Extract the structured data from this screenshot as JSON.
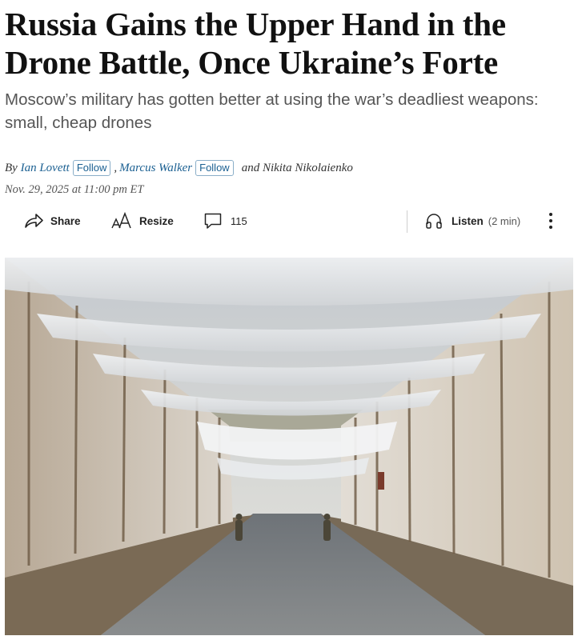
{
  "article": {
    "headline": "Russia Gains the Upper Hand in the Drone Battle, Once Ukraine’s Forte",
    "dek": "Moscow’s military has gotten better at using the war’s deadliest weapons: small, cheap drones",
    "byline": {
      "prefix": "By",
      "authors": [
        {
          "name": "Ian Lovett",
          "follow_label": "Follow"
        },
        {
          "name": "Marcus Walker",
          "follow_label": "Follow"
        }
      ],
      "separator": ",",
      "and_text": "and Nikita Nikolaienko"
    },
    "date": "Nov. 29, 2025 at 11:00 pm ET"
  },
  "toolbar": {
    "share": {
      "label": "Share",
      "icon": "share-arrow-icon"
    },
    "resize": {
      "label": "Resize",
      "icon": "text-resize-icon"
    },
    "comments": {
      "count": "115",
      "icon": "comment-bubble-icon"
    },
    "listen": {
      "label": "Listen",
      "duration": "(2 min)",
      "icon": "headphones-icon"
    },
    "more": {
      "icon": "more-vertical-icon"
    }
  },
  "hero_image": {
    "icon": "photo-road-under-anti-drone-netting"
  },
  "colors": {
    "text": "#111111",
    "dek": "#555555",
    "link": "#1a5f91"
  }
}
